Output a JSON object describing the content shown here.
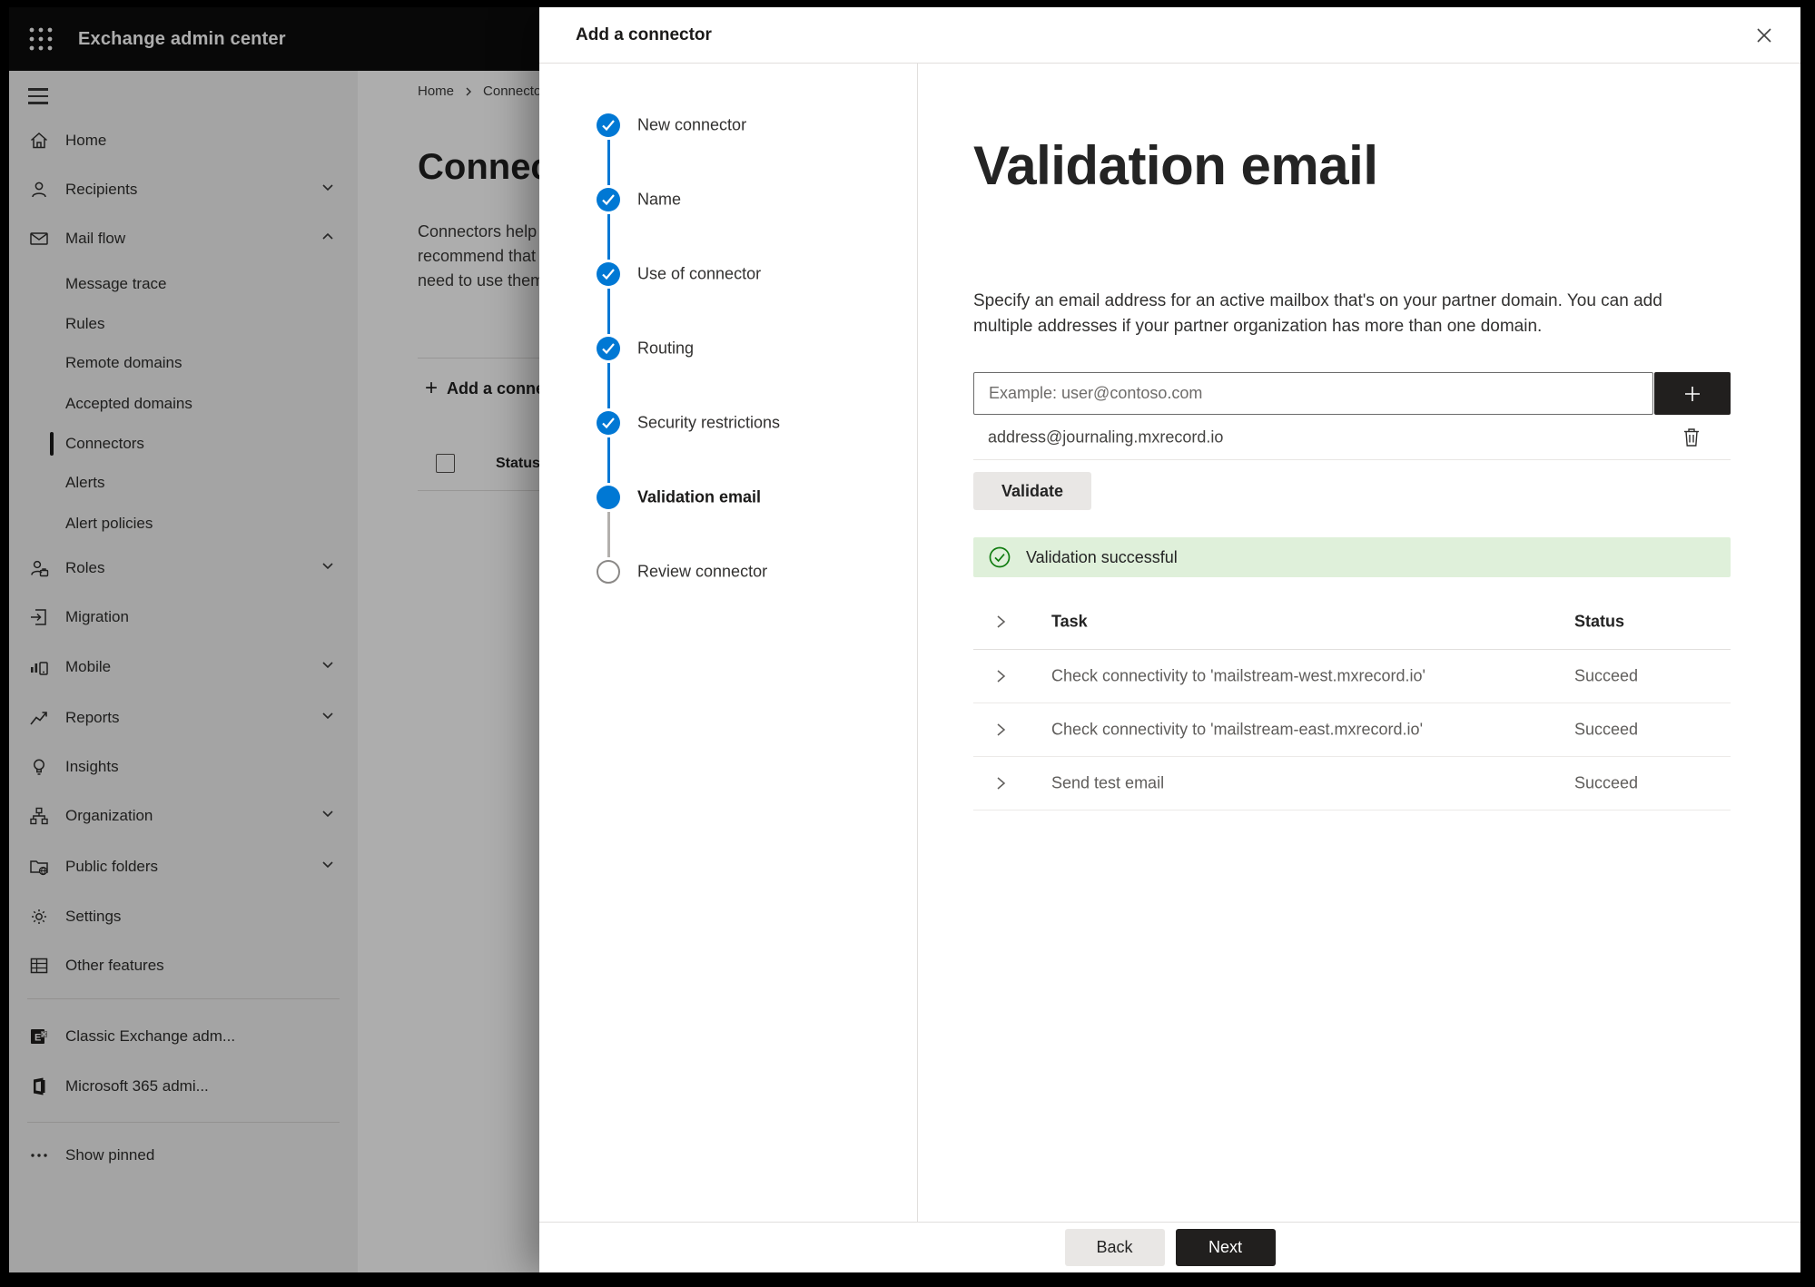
{
  "app": {
    "title": "Exchange admin center"
  },
  "sidebar": {
    "items": [
      {
        "label": "Home",
        "icon": "home-icon",
        "type": "item"
      },
      {
        "label": "Recipients",
        "icon": "person-icon",
        "type": "item",
        "chevron": "down"
      },
      {
        "label": "Mail flow",
        "icon": "mail-icon",
        "type": "item",
        "chevron": "up"
      },
      {
        "label": "Message trace",
        "type": "subitem"
      },
      {
        "label": "Rules",
        "type": "subitem"
      },
      {
        "label": "Remote domains",
        "type": "subitem"
      },
      {
        "label": "Accepted domains",
        "type": "subitem"
      },
      {
        "label": "Connectors",
        "type": "subitem",
        "selected": true
      },
      {
        "label": "Alerts",
        "type": "subitem"
      },
      {
        "label": "Alert policies",
        "type": "subitem"
      },
      {
        "label": "Roles",
        "icon": "roles-icon",
        "type": "item",
        "chevron": "down"
      },
      {
        "label": "Migration",
        "icon": "migration-icon",
        "type": "item"
      },
      {
        "label": "Mobile",
        "icon": "mobile-icon",
        "type": "item",
        "chevron": "down"
      },
      {
        "label": "Reports",
        "icon": "reports-icon",
        "type": "item",
        "chevron": "down"
      },
      {
        "label": "Insights",
        "icon": "insights-icon",
        "type": "item"
      },
      {
        "label": "Organization",
        "icon": "organization-icon",
        "type": "item",
        "chevron": "down"
      },
      {
        "label": "Public folders",
        "icon": "public-folders-icon",
        "type": "item",
        "chevron": "down"
      },
      {
        "label": "Settings",
        "icon": "settings-icon",
        "type": "item"
      },
      {
        "label": "Other features",
        "icon": "other-features-icon",
        "type": "item"
      },
      {
        "label": "Classic Exchange adm...",
        "icon": "classic-exchange-icon",
        "type": "item"
      },
      {
        "label": "Microsoft 365 admi...",
        "icon": "microsoft-365-icon",
        "type": "item"
      },
      {
        "label": "Show pinned",
        "icon": "ellipsis-icon",
        "type": "item"
      }
    ]
  },
  "background_page": {
    "breadcrumb": [
      "Home",
      "Connectors"
    ],
    "heading": "Connectors",
    "paragraph_lines": [
      "Connectors help",
      "recommend that",
      "need to use them"
    ],
    "add_button_label": "Add a connector",
    "column_header": "Status"
  },
  "wizard": {
    "title": "Add a connector",
    "steps": [
      {
        "label": "New connector",
        "state": "completed"
      },
      {
        "label": "Name",
        "state": "completed"
      },
      {
        "label": "Use of connector",
        "state": "completed"
      },
      {
        "label": "Routing",
        "state": "completed"
      },
      {
        "label": "Security restrictions",
        "state": "completed"
      },
      {
        "label": "Validation email",
        "state": "current"
      },
      {
        "label": "Review connector",
        "state": "upcoming"
      }
    ],
    "page": {
      "heading": "Validation email",
      "description": "Specify an email address for an active mailbox that's on your partner domain. You can add multiple addresses if your partner organization has more than one domain.",
      "email_input": {
        "value": "",
        "placeholder": "Example: user@contoso.com"
      },
      "added_addresses": [
        "address@journaling.mxrecord.io"
      ],
      "validate_button_label": "Validate",
      "validation_banner": "Validation successful",
      "results_table": {
        "columns": [
          "Task",
          "Status"
        ],
        "rows": [
          {
            "task": "Check connectivity to 'mailstream-west.mxrecord.io'",
            "status": "Succeed"
          },
          {
            "task": "Check connectivity to 'mailstream-east.mxrecord.io'",
            "status": "Succeed"
          },
          {
            "task": "Send test email",
            "status": "Succeed"
          }
        ]
      }
    },
    "footer": {
      "back_label": "Back",
      "next_label": "Next"
    }
  }
}
